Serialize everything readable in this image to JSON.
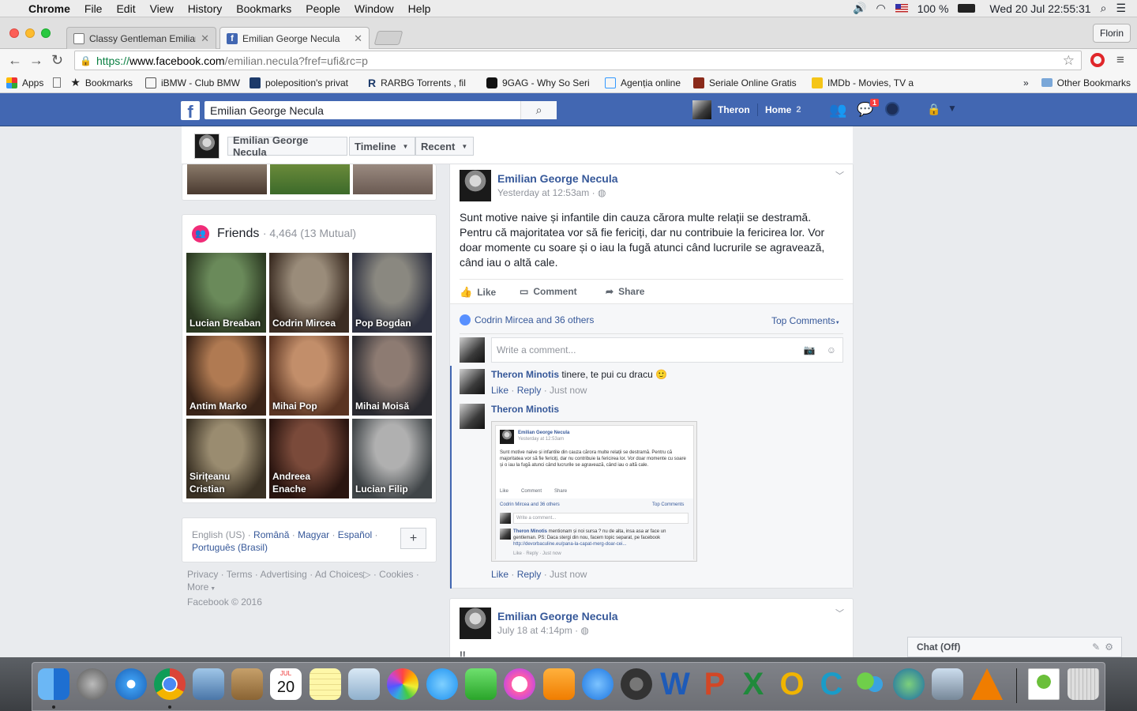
{
  "menubar": {
    "app": "Chrome",
    "items": [
      "File",
      "Edit",
      "View",
      "History",
      "Bookmarks",
      "People",
      "Window",
      "Help"
    ],
    "battery": "100 %",
    "datetime": "Wed 20 Jul  22:55:31"
  },
  "browser": {
    "tabs": [
      {
        "title": "Classy Gentleman Emilianu"
      },
      {
        "title": "Emilian George Necula"
      }
    ],
    "profile": "Florin",
    "url_scheme": "https://",
    "url_host": "www.facebook.com",
    "url_path": "/emilian.necula?fref=ufi&rc=p"
  },
  "bookmarks": {
    "items": [
      "Apps",
      "Bookmarks",
      "iBMW - Club BMW",
      "poleposition's privat",
      "RARBG Torrents , fil",
      "9GAG - Why So Seri",
      "Agenția online",
      "Seriale Online Gratis",
      "IMDb - Movies, TV a"
    ],
    "overflow": "»",
    "other": "Other Bookmarks"
  },
  "fb": {
    "search_value": "Emilian George Necula",
    "user": "Theron",
    "home": "Home",
    "home_count": "2",
    "notif_count": "1"
  },
  "timeline_nav": {
    "name": "Emilian George Necula",
    "timeline": "Timeline",
    "recent": "Recent"
  },
  "friends": {
    "title": "Friends",
    "count": "· 4,464 (13 Mutual)",
    "list": [
      {
        "name": "Lucian Breaban",
        "c1": "#6a8a5a",
        "c2": "#2c3a22"
      },
      {
        "name": "Codrin Mircea",
        "c1": "#9a8c7a",
        "c2": "#3b2c22"
      },
      {
        "name": "Pop Bogdan",
        "c1": "#8a8880",
        "c2": "#2e3140"
      },
      {
        "name": "Antim Marko",
        "c1": "#b07a52",
        "c2": "#3a2418"
      },
      {
        "name": "Mihai Pop",
        "c1": "#c28e6a",
        "c2": "#5a3422"
      },
      {
        "name": "Mihai Moisă",
        "c1": "#8d7b72",
        "c2": "#2a2a30"
      },
      {
        "name": "Sirițeanu Cristian",
        "c1": "#9a8c70",
        "c2": "#3a3124"
      },
      {
        "name": "Andreea Enache",
        "c1": "#7a4a3a",
        "c2": "#2a1510"
      },
      {
        "name": "Lucian Filip",
        "c1": "#b0b0b0",
        "c2": "#404548"
      }
    ]
  },
  "languages": {
    "current": "English (US)",
    "others": [
      "Română",
      "Magyar",
      "Español",
      "Português (Brasil)"
    ],
    "sep": "·",
    "add": "+"
  },
  "footer": {
    "links": [
      "Privacy",
      "Terms",
      "Advertising",
      "Ad Choices",
      "Cookies",
      "More"
    ],
    "copyright": "Facebook © 2016"
  },
  "post1": {
    "author": "Emilian George Necula",
    "time": "Yesterday at 12:53am",
    "text": "Sunt motive naive și infantile din cauza cărora multe relații se destramă. Pentru că majoritatea vor să fie fericiți, dar nu contribuie la fericirea lor. Vor doar momente cu soare și o iau la fugă atunci când lucrurile se agravează, când iau o altă cale.",
    "like": "Like",
    "comment": "Comment",
    "share": "Share",
    "likers": "Codrin Mircea and 36 others",
    "top_comments": "Top Comments",
    "comment_placeholder": "Write a comment..."
  },
  "comments": [
    {
      "author": "Theron Minotis",
      "text": "tinere, te pui cu dracu 🙂",
      "like": "Like",
      "reply": "Reply",
      "time": "Just now"
    },
    {
      "author": "Theron Minotis",
      "text": "",
      "like": "Like",
      "reply": "Reply",
      "time": "Just now"
    }
  ],
  "screenshot": {
    "author": "Emilian George Necula",
    "time": "Yesterday at 12:53am",
    "text": "Sunt motive naive și infantile din cauza cărora multe relații se destramă. Pentru că majoritatea vor să fie fericiți, dar nu contribuie la fericirea lor. Vor doar momente cu soare și o iau la fugă atunci când lucrurile se agravează, când iau o altă cale.",
    "like": "Like",
    "comment": "Comment",
    "share": "Share",
    "likers": "Codrin Mircea and 36 others",
    "top": "Top Comments",
    "placeholder": "Write a comment...",
    "reply_author": "Theron Minotis",
    "reply_text": "mentionam și noi sursa ? nu de alta, insa asa ar face un gentleman. PS: Daca stergi din nou, facem topic separat, pe facebook",
    "reply_link": "http://devorbaculine.eu/pana-la-capat-merg-doar-cei...",
    "reply_meta": "Like · Reply · Just now"
  },
  "post2": {
    "author": "Emilian George Necula",
    "time": "July 18 at 4:14pm",
    "text": "!!"
  },
  "chat": {
    "label": "Chat (Off)"
  },
  "dock": {
    "calendar_month": "JUL",
    "calendar_day": "20"
  }
}
